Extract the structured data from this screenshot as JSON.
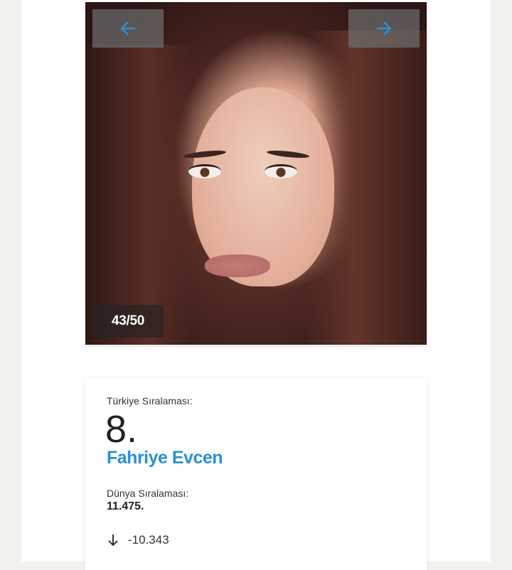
{
  "gallery": {
    "counter": "43/50",
    "prev_icon": "arrow-left-icon",
    "next_icon": "arrow-right-icon",
    "accent_color": "#2a8fd6"
  },
  "ranking": {
    "turkey_label": "Türkiye Sıralaması:",
    "turkey_rank": "8.",
    "name": "Fahriye Evcen",
    "world_label": "Dünya Sıralaması:",
    "world_rank": "11.475.",
    "change_icon": "arrow-down-icon",
    "change_value": "-10.343"
  }
}
